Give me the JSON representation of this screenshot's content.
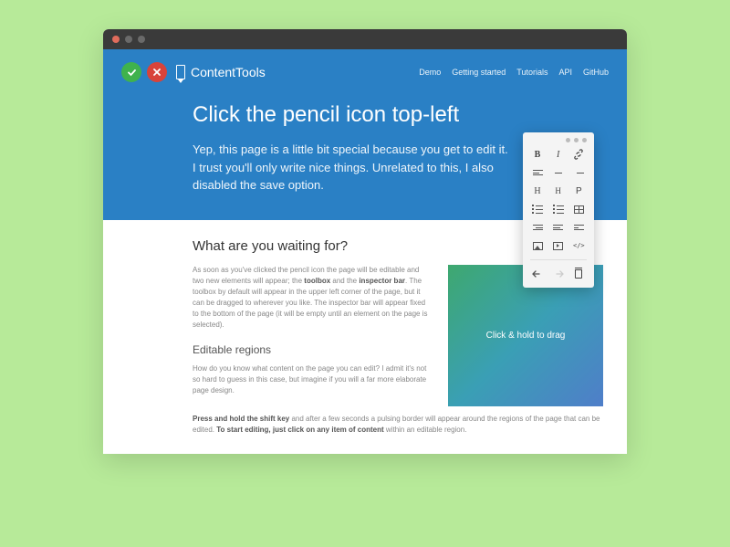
{
  "brand": "ContentTools",
  "nav": {
    "demo": "Demo",
    "getting_started": "Getting started",
    "tutorials": "Tutorials",
    "api": "API",
    "github": "GitHub"
  },
  "hero": {
    "title": "Click the pencil icon top-left",
    "body": "Yep, this page is a little bit special because you get to edit it. I trust you'll only write nice things. Unrelated to this, I also disabled the save option."
  },
  "content": {
    "h2": "What are you waiting for?",
    "p1a": "As soon as you've clicked the pencil icon the page will be editable and two new elements will appear; the ",
    "p1b_bold": "toolbox",
    "p1c": " and the ",
    "p1d_bold": "inspector bar",
    "p1e": ". The toolbox by default will appear in the upper left corner of the page, but it can be dragged to wherever you like. The inspector bar will appear fixed to the bottom of the page (it will be empty until an element on the page is selected).",
    "h3": "Editable regions",
    "p2": "How do you know what content on the page you can edit? I admit it's not so hard to guess in this case, but imagine if you will a far more elaborate page design.",
    "p3a_bold": "Press and hold the shift key",
    "p3b": " and after a few seconds a pulsing border will appear around the regions of the page that can be edited. ",
    "p3c_bold": "To start editing, just click on any item of content",
    "p3d": " within an editable region.",
    "drag_label": "Click & hold to drag"
  },
  "toolbox": {
    "bold": "B",
    "italic": "I",
    "link": "🔗",
    "h1": "H",
    "h2": "H",
    "p": "P",
    "code": "</>"
  }
}
